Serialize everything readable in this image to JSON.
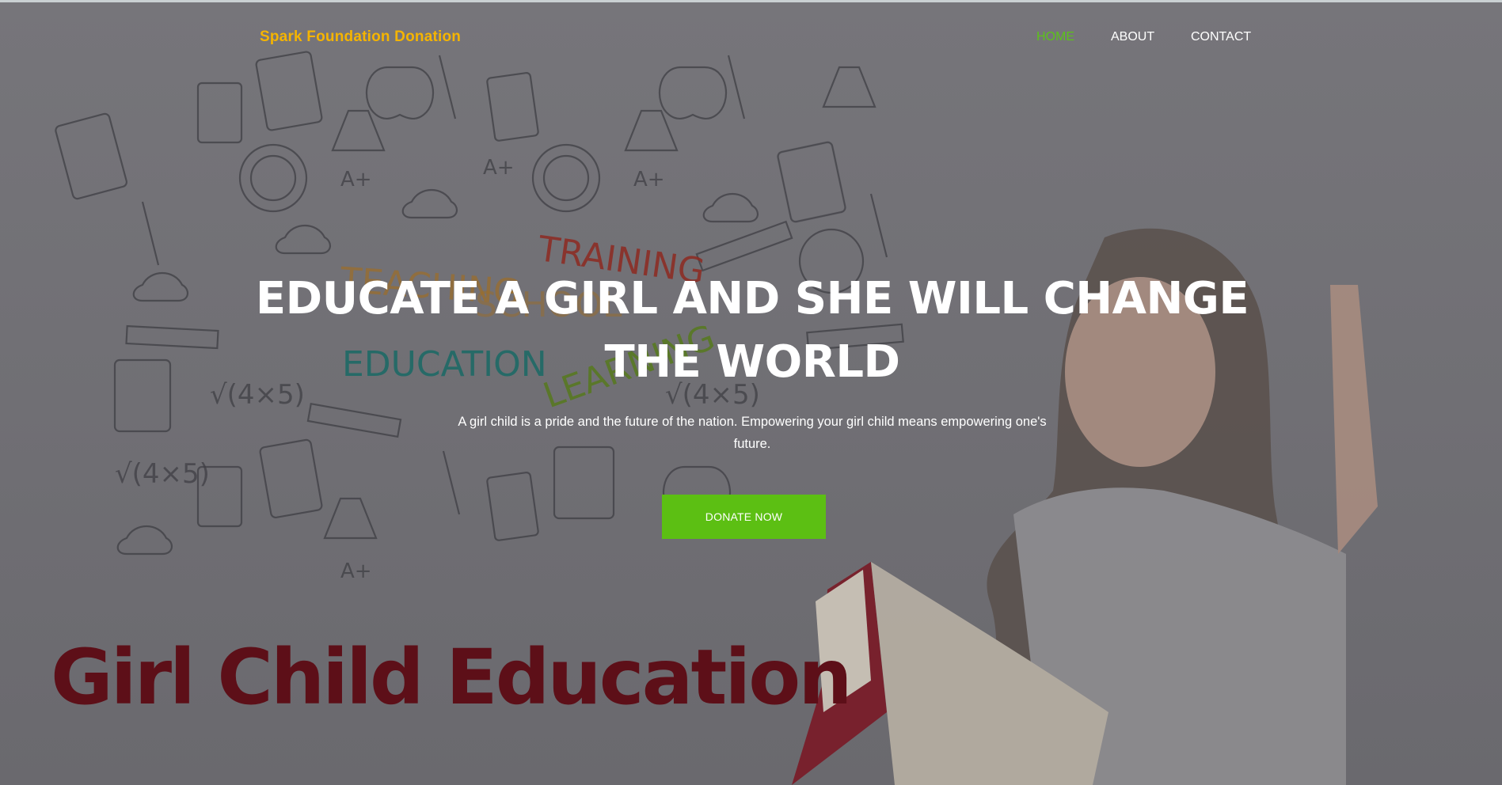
{
  "brand": "Spark Foundation Donation",
  "nav": [
    {
      "label": "HOME",
      "active": true
    },
    {
      "label": "ABOUT",
      "active": false
    },
    {
      "label": "CONTACT",
      "active": false
    }
  ],
  "hero": {
    "title": "EDUCATE A GIRL AND SHE WILL CHANGE THE WORLD",
    "subtitle": "A girl child is a pride and the future of the nation. Empowering your girl child means empowering one's future.",
    "button": "DONATE NOW"
  },
  "background_text": {
    "words": [
      "TEACHING",
      "SCHOOL",
      "TRAINING",
      "EDUCATION",
      "LEARNING"
    ],
    "caption": "Girl Child Education"
  },
  "colors": {
    "brand": "#f5b400",
    "accent": "#5cbf13",
    "caption": "#5d0f18"
  }
}
